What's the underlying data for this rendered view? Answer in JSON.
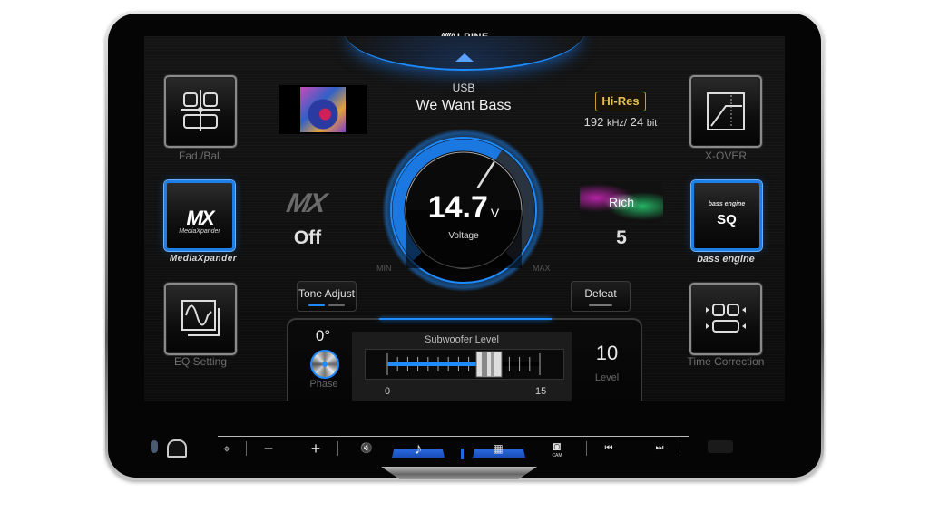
{
  "device": {
    "brand": "ALPINE",
    "brand_slashes": "/////"
  },
  "header": {
    "source": "USB",
    "track_title": "We Want Bass",
    "hires_badge": "Hi-Res",
    "sample_rate": "192",
    "sample_rate_unit": "kHz/",
    "bit_depth": "24",
    "bit_depth_unit": "bit"
  },
  "tiles": {
    "fader_balance": {
      "label": "Fad./Bal.",
      "icon": "fader-balance-icon"
    },
    "xover": {
      "label": "X-OVER",
      "icon": "crossover-icon"
    },
    "eq_setting": {
      "label": "EQ Setting",
      "icon": "eq-wave-icon"
    },
    "time_correction": {
      "label": "Time Correction",
      "icon": "time-correction-icon"
    },
    "media_xpander": {
      "label": "MediaXpander",
      "tile_text": "MX",
      "tile_subtext": "MediaXpander"
    },
    "bass_engine": {
      "label": "bass engine",
      "tile_text": "SQ",
      "tile_subtext": "bass engine"
    }
  },
  "mx": {
    "logo": "MX",
    "state": "Off"
  },
  "bass_engine_preset": {
    "name": "Rich",
    "level": "5"
  },
  "gauge": {
    "value": "14.7",
    "unit": "V",
    "label": "Voltage",
    "min_label": "MIN",
    "max_label": "MAX",
    "fill_fraction": 0.62
  },
  "buttons": {
    "tone_adjust": "Tone Adjust",
    "defeat": "Defeat"
  },
  "subwoofer": {
    "phase_value": "0°",
    "phase_label": "Phase",
    "title": "Subwoofer Level",
    "min": "0",
    "max": "15",
    "level": 10,
    "level_text": "10",
    "level_label": "Level"
  },
  "control_bar": {
    "items": [
      {
        "name": "navigation-icon",
        "glyph": "⌖"
      },
      {
        "name": "volume-down-button",
        "glyph": "−"
      },
      {
        "name": "volume-up-button",
        "glyph": "+"
      },
      {
        "name": "mute-icon",
        "glyph": "🔇"
      },
      {
        "name": "audio-icon",
        "glyph": "♪"
      },
      {
        "name": "menu-grid-icon",
        "glyph": "▦"
      },
      {
        "name": "camera-icon",
        "glyph": "◙",
        "caption": "CAM"
      },
      {
        "name": "previous-track-icon",
        "glyph": "⏮"
      },
      {
        "name": "next-track-icon",
        "glyph": "⏭"
      }
    ]
  },
  "colors": {
    "accent_blue": "#1e8bff",
    "hires_gold": "#e8c050"
  }
}
